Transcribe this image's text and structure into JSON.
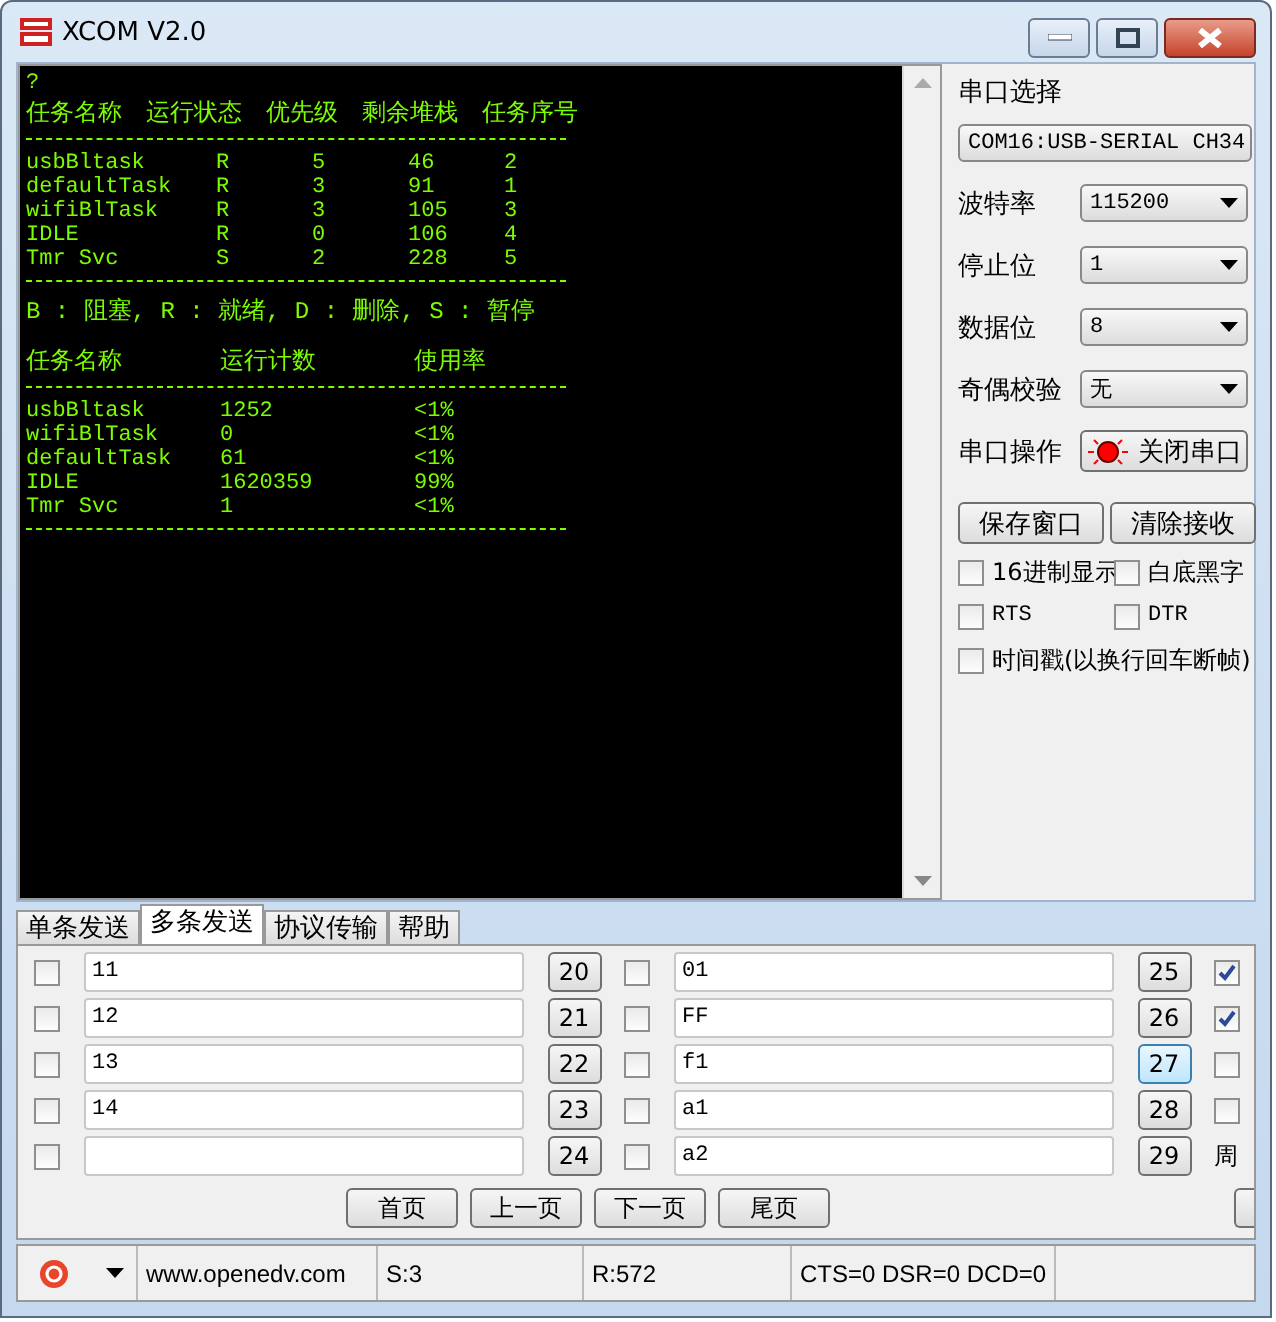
{
  "window": {
    "title": "XCOM V2.0"
  },
  "terminal": {
    "lines": [
      {
        "kind": "plain",
        "cells": [
          "?"
        ]
      },
      {
        "kind": "head5",
        "cells": [
          "任务名称",
          "运行状态",
          "优先级",
          "剩余堆栈",
          "任务序号"
        ]
      },
      {
        "kind": "rule"
      },
      {
        "kind": "row5",
        "cells": [
          "usbBltask",
          "R",
          "5",
          "46",
          "2"
        ]
      },
      {
        "kind": "row5",
        "cells": [
          "defaultTask",
          "R",
          "3",
          "91",
          "1"
        ]
      },
      {
        "kind": "row5",
        "cells": [
          "wifiBlTask",
          "R",
          "3",
          "105",
          "3"
        ]
      },
      {
        "kind": "row5",
        "cells": [
          "IDLE",
          "R",
          "0",
          "106",
          "4"
        ]
      },
      {
        "kind": "row5",
        "cells": [
          "Tmr Svc",
          "S",
          "2",
          "228",
          "5"
        ]
      },
      {
        "kind": "rule"
      },
      {
        "kind": "legend",
        "cells": [
          "B : 阻塞, R : 就绪, D : 删除, S : 暂停"
        ]
      },
      {
        "kind": "head3",
        "cells": [
          "任务名称",
          "运行计数",
          "使用率"
        ]
      },
      {
        "kind": "rule"
      },
      {
        "kind": "row3",
        "cells": [
          "usbBltask",
          "1252",
          "<1%"
        ]
      },
      {
        "kind": "row3",
        "cells": [
          "wifiBlTask",
          "0",
          "<1%"
        ]
      },
      {
        "kind": "row3",
        "cells": [
          "defaultTask",
          "61",
          "<1%"
        ]
      },
      {
        "kind": "row3",
        "cells": [
          "IDLE",
          "1620359",
          "99%"
        ]
      },
      {
        "kind": "row3",
        "cells": [
          "Tmr Svc",
          "1",
          "<1%"
        ]
      },
      {
        "kind": "rule"
      }
    ]
  },
  "settings": {
    "port_label": "串口选择",
    "port_value": "COM16:USB-SERIAL CH34",
    "fields": [
      {
        "label": "波特率",
        "value": "115200"
      },
      {
        "label": "停止位",
        "value": "1"
      },
      {
        "label": "数据位",
        "value": "8"
      },
      {
        "label": "奇偶校验",
        "value": "无"
      }
    ],
    "operation": {
      "label": "串口操作",
      "button": "关闭串口"
    },
    "buttons": [
      "保存窗口",
      "清除接收"
    ],
    "options": [
      {
        "label": "16进制显示",
        "checked": false
      },
      {
        "label": "白底黑字",
        "checked": false
      },
      {
        "label": "RTS",
        "checked": false
      },
      {
        "label": "DTR",
        "checked": false
      },
      {
        "label": "时间戳(以换行回车断帧)",
        "checked": false
      }
    ]
  },
  "tabs": [
    {
      "label": "单条发送",
      "selected": false
    },
    {
      "label": "多条发送",
      "selected": true
    },
    {
      "label": "协议传输",
      "selected": false
    },
    {
      "label": "帮助",
      "selected": false
    }
  ],
  "send_columns": [
    [
      {
        "checked": false,
        "text": "11",
        "button": "20",
        "focused": false
      },
      {
        "checked": false,
        "text": "12",
        "button": "21",
        "focused": false
      },
      {
        "checked": false,
        "text": "13",
        "button": "22",
        "focused": false
      },
      {
        "checked": false,
        "text": "14",
        "button": "23",
        "focused": false
      },
      {
        "checked": false,
        "text": "",
        "button": "24",
        "focused": false
      }
    ],
    [
      {
        "checked": false,
        "text": "01",
        "button": "25",
        "focused": false
      },
      {
        "checked": false,
        "text": "FF",
        "button": "26",
        "focused": false
      },
      {
        "checked": false,
        "text": "f1",
        "button": "27",
        "focused": true
      },
      {
        "checked": false,
        "text": "a1",
        "button": "28",
        "focused": false
      },
      {
        "checked": false,
        "text": "a2",
        "button": "29",
        "focused": false
      }
    ]
  ],
  "loop_checks": [
    {
      "checked": true
    },
    {
      "checked": true
    },
    {
      "checked": false
    },
    {
      "checked": false
    }
  ],
  "loop_label": "周",
  "pager": [
    "首页",
    "上一页",
    "下一页",
    "尾页"
  ],
  "status_bar": {
    "site": "www.openedv.com",
    "sent": "S:3",
    "received": "R:572",
    "lines": "CTS=0 DSR=0 DCD=0"
  }
}
